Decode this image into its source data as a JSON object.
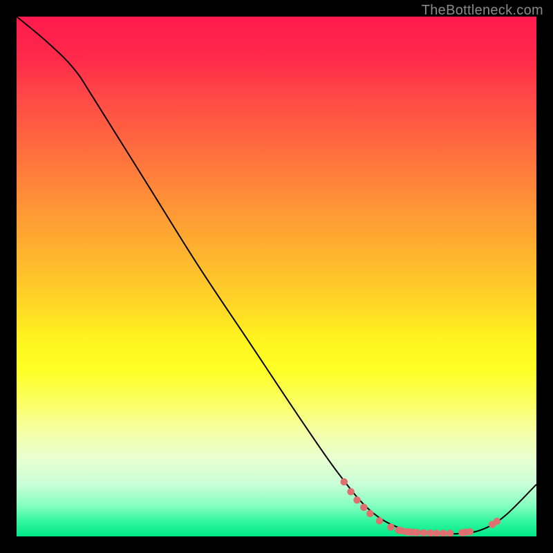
{
  "watermark": "TheBottleneck.com",
  "chart_data": {
    "type": "line",
    "title": "",
    "xlabel": "",
    "ylabel": "",
    "xlim": [
      0,
      100
    ],
    "ylim": [
      0,
      100
    ],
    "series": [
      {
        "name": "curve",
        "points": [
          {
            "x": 0,
            "y": 100
          },
          {
            "x": 6,
            "y": 95
          },
          {
            "x": 11,
            "y": 90
          },
          {
            "x": 15,
            "y": 84
          },
          {
            "x": 25,
            "y": 68
          },
          {
            "x": 35,
            "y": 52
          },
          {
            "x": 45,
            "y": 37
          },
          {
            "x": 55,
            "y": 22
          },
          {
            "x": 62,
            "y": 12
          },
          {
            "x": 68,
            "y": 5
          },
          {
            "x": 74,
            "y": 1.5
          },
          {
            "x": 80,
            "y": 0.6
          },
          {
            "x": 86,
            "y": 0.6
          },
          {
            "x": 90,
            "y": 1.5
          },
          {
            "x": 94,
            "y": 4
          },
          {
            "x": 100,
            "y": 10
          }
        ]
      }
    ],
    "dots": {
      "color": "#e07070",
      "radius": 5,
      "points": [
        {
          "x": 63,
          "y": 10.5
        },
        {
          "x": 64.3,
          "y": 8.6
        },
        {
          "x": 65.5,
          "y": 7.0
        },
        {
          "x": 66.8,
          "y": 5.6
        },
        {
          "x": 68.0,
          "y": 4.4
        },
        {
          "x": 69.8,
          "y": 3.0
        },
        {
          "x": 72.0,
          "y": 1.8
        },
        {
          "x": 73.5,
          "y": 1.2
        },
        {
          "x": 74.0,
          "y": 1.1
        },
        {
          "x": 75.0,
          "y": 0.9
        },
        {
          "x": 75.7,
          "y": 0.85
        },
        {
          "x": 76.2,
          "y": 0.8
        },
        {
          "x": 77.0,
          "y": 0.75
        },
        {
          "x": 78.3,
          "y": 0.7
        },
        {
          "x": 79.6,
          "y": 0.65
        },
        {
          "x": 80.8,
          "y": 0.6
        },
        {
          "x": 82.1,
          "y": 0.6
        },
        {
          "x": 83.4,
          "y": 0.6
        },
        {
          "x": 85.7,
          "y": 0.7
        },
        {
          "x": 86.3,
          "y": 0.8
        },
        {
          "x": 87.2,
          "y": 0.9
        },
        {
          "x": 91.5,
          "y": 2.3
        },
        {
          "x": 92.4,
          "y": 2.9
        }
      ]
    }
  }
}
